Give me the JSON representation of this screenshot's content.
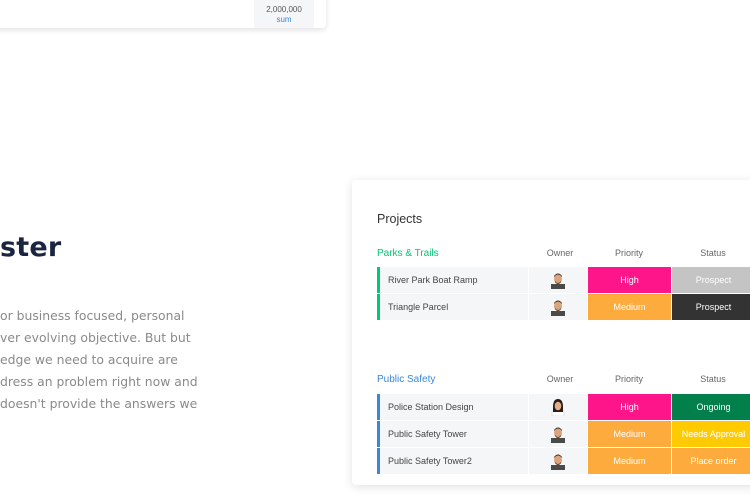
{
  "top_card": {
    "sum_value": "2,000,000",
    "sum_label": "sum"
  },
  "headline": "ster",
  "paragraph_lines": [
    "or business focused, personal",
    "ver evolving objective. But but",
    "edge we need to acquire are",
    "dress an problem right now and",
    "doesn't provide the answers we"
  ],
  "board": {
    "title": "Projects",
    "columns": {
      "owner": "Owner",
      "priority": "Priority",
      "status": "Status"
    },
    "groups": [
      {
        "name": "Parks & Trails",
        "color": "#00c875",
        "rows": [
          {
            "name": "River Park Boat Ramp",
            "priority": "High",
            "priority_color": "#ff158a",
            "status": "Prospect",
            "status_color": "#c4c4c4",
            "owner": "male-avatar"
          },
          {
            "name": "Triangle Parcel",
            "priority": "Medium",
            "priority_color": "#fdab3d",
            "status": "Prospect",
            "status_color": "#333333",
            "owner": "male-avatar"
          }
        ]
      },
      {
        "name": "Public Safety",
        "color": "#3a87d8",
        "rows": [
          {
            "name": "Police Station Design",
            "priority": "High",
            "priority_color": "#ff158a",
            "status": "Ongoing",
            "status_color": "#037f4c",
            "owner": "female-avatar"
          },
          {
            "name": "Public Safety Tower",
            "priority": "Medium",
            "priority_color": "#fdab3d",
            "status": "Needs Approval",
            "status_color": "#ffcb00",
            "owner": "male-avatar"
          },
          {
            "name": "Public Safety Tower2",
            "priority": "Medium",
            "priority_color": "#fdab3d",
            "status": "Place order",
            "status_color": "#fdab3d",
            "owner": "male-avatar"
          }
        ]
      }
    ]
  }
}
